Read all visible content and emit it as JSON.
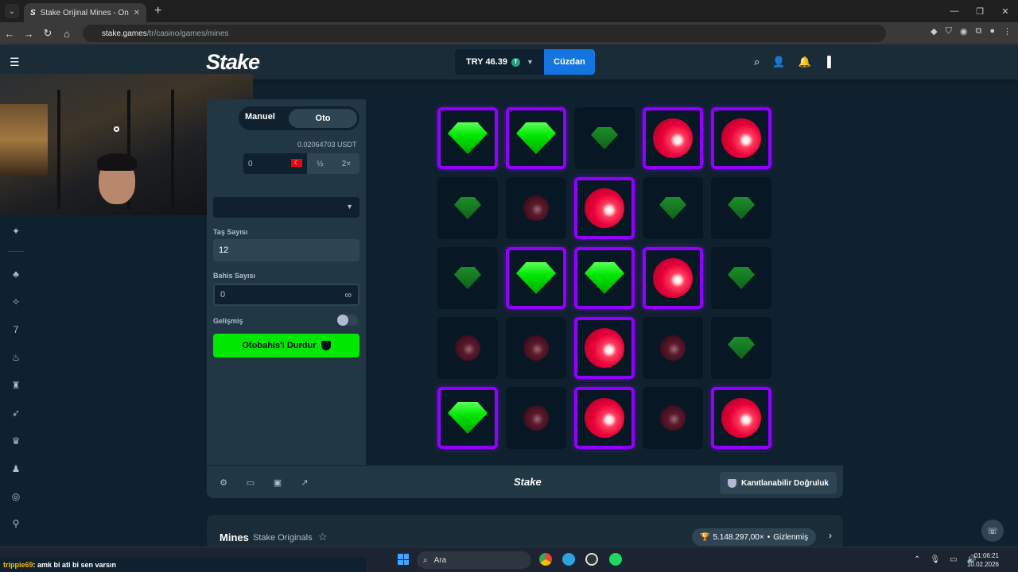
{
  "browser": {
    "tab_title": "Stake Orijinal Mines - Online Casino",
    "tab_favicon": "S",
    "url_host": "stake.games",
    "url_path": "/tr/casino/games/mines"
  },
  "header": {
    "logo": "Stake",
    "balance": "TRY 46.39",
    "wallet_label": "Cüzdan"
  },
  "sidebar_game": {
    "mode_manual": "Manuel",
    "mode_auto": "Oto",
    "bet_amount_value": "0.02064703 USDT",
    "bet_input": "0",
    "half": "½",
    "double": "2×",
    "gems_label": "Taş Sayısı",
    "gems_value": "12",
    "bets_label": "Bahis Sayısı",
    "bets_value": "0",
    "bets_icon": "∞",
    "advanced_label": "Gelişmiş",
    "stop_button": "Otobahis'i Durdur"
  },
  "grid": [
    [
      "gem-rev",
      "gem-rev",
      "gem-dim",
      "bomb-rev",
      "bomb-rev"
    ],
    [
      "gem-dim",
      "bomb-dim",
      "bomb-rev",
      "gem-dim",
      "gem-dim"
    ],
    [
      "gem-dim",
      "gem-rev",
      "gem-rev",
      "bomb-rev",
      "gem-dim"
    ],
    [
      "bomb-dim",
      "bomb-dim",
      "bomb-rev",
      "bomb-dim",
      "gem-dim"
    ],
    [
      "gem-rev",
      "bomb-dim",
      "bomb-rev",
      "bomb-dim",
      "bomb-rev"
    ]
  ],
  "bottom_bar": {
    "logo": "Stake",
    "fairness": "Kanıtlanabilir Doğruluk"
  },
  "info": {
    "game": "Mines",
    "provider": "Stake Originals",
    "max_win": "5.148.297,00×",
    "hidden": "Gizlenmiş"
  },
  "chat": {
    "user": "trippie69",
    "message": ": amk bi ati bi sen varsın"
  },
  "taskbar": {
    "search": "Ara",
    "time": "01:06:21",
    "date": "10.02.2026"
  },
  "colors": {
    "accent_green": "#00e701",
    "reveal_border": "#9000ff",
    "wallet_blue": "#1475e1",
    "bomb_red": "#e8003a"
  }
}
